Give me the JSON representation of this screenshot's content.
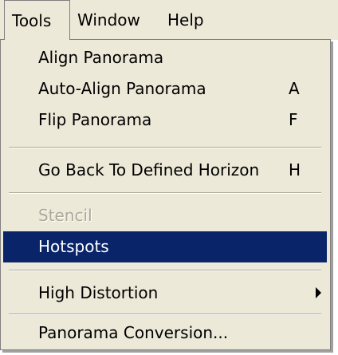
{
  "menubar": {
    "items": [
      {
        "label": "Tools"
      },
      {
        "label": "Window"
      },
      {
        "label": "Help"
      }
    ]
  },
  "tools_menu": {
    "items": [
      {
        "label": "Align Panorama",
        "shortcut": ""
      },
      {
        "label": "Auto-Align Panorama",
        "shortcut": "A"
      },
      {
        "label": "Flip Panorama",
        "shortcut": "F"
      },
      {
        "label": "Go Back To Defined Horizon",
        "shortcut": "H"
      },
      {
        "label": "Stencil",
        "shortcut": "",
        "disabled": true
      },
      {
        "label": "Hotspots",
        "shortcut": "",
        "highlighted": true
      },
      {
        "label": "High Distortion",
        "shortcut": "",
        "submenu": true
      },
      {
        "label": "Panorama Conversion...",
        "shortcut": ""
      }
    ]
  },
  "colors": {
    "menu_background": "#ece9d8",
    "highlight": "#0a246a",
    "highlight_text": "#ffffff",
    "disabled_text": "#aca899"
  }
}
